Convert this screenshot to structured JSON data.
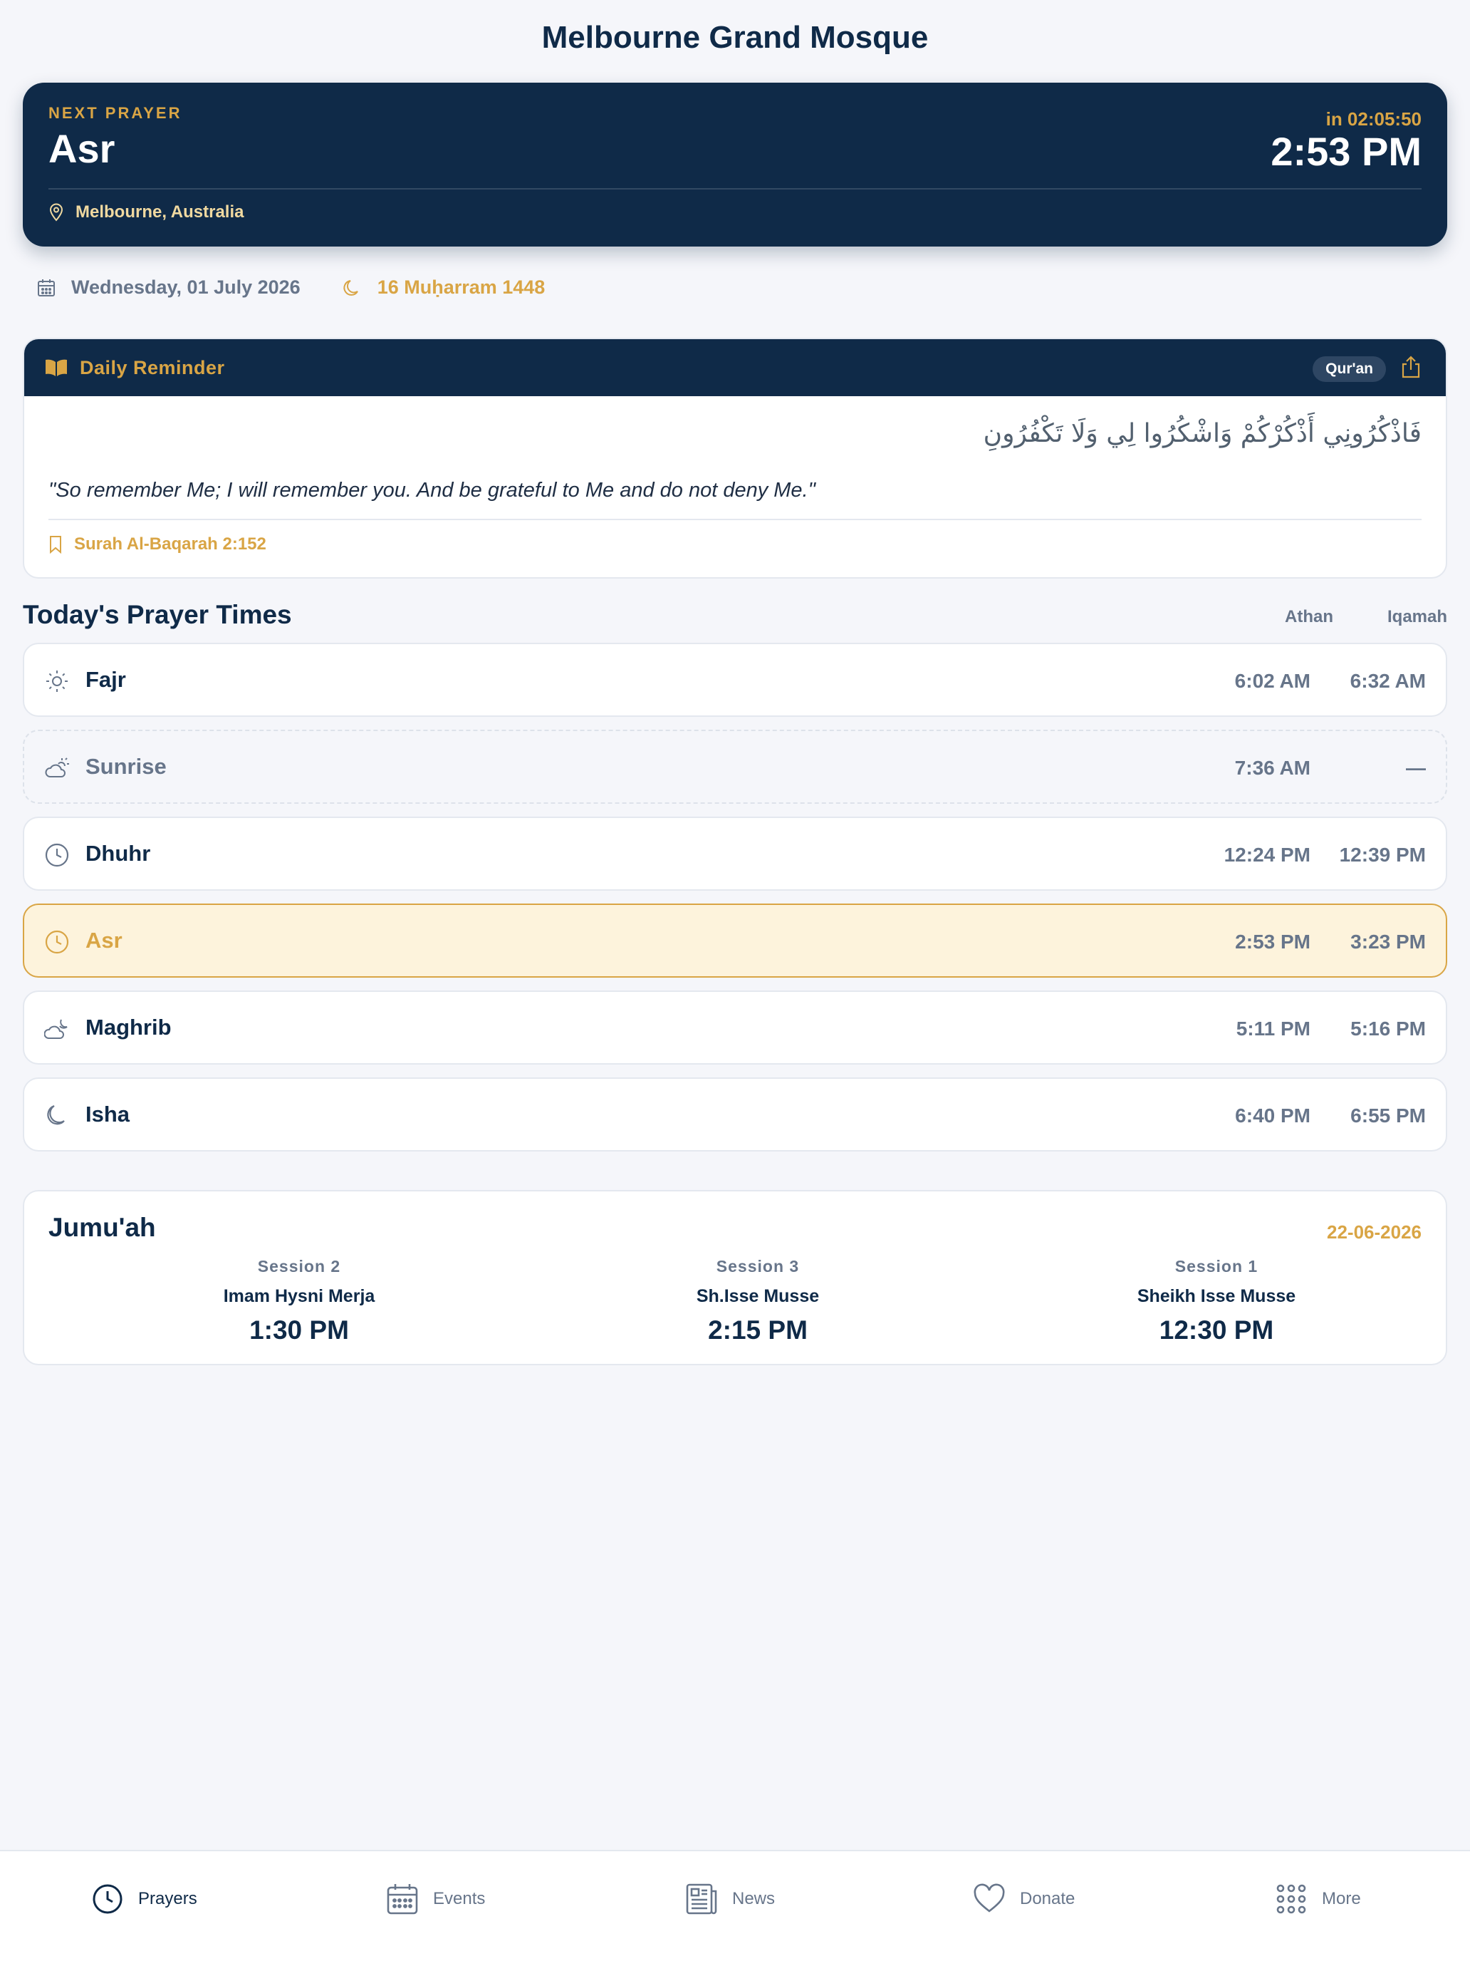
{
  "app": {
    "title": "Melbourne Grand Mosque"
  },
  "next_prayer": {
    "label": "NEXT PRAYER",
    "name": "Asr",
    "countdown": "in 02:05:50",
    "time": "2:53 PM",
    "location": "Melbourne, Australia"
  },
  "dates": {
    "gregorian": "Wednesday, 01 July 2026",
    "hijri": "16 Muḥarram 1448"
  },
  "reminder": {
    "title": "Daily Reminder",
    "tag": "Qur'an",
    "arabic": "فَاذْكُرُونِي أَذْكُرْكُمْ وَاشْكُرُوا لِي وَلَا تَكْفُرُونِ",
    "translation": "\"So remember Me; I will remember you. And be grateful to Me and do not deny Me.\"",
    "reference": "Surah Al-Baqarah 2:152"
  },
  "prayer_times": {
    "title": "Today's Prayer Times",
    "col_athan": "Athan",
    "col_iqamah": "Iqamah",
    "rows": [
      {
        "name": "Fajr",
        "athan": "6:02 AM",
        "iqamah": "6:32 AM",
        "icon": "sun-icon"
      },
      {
        "name": "Sunrise",
        "athan": "7:36 AM",
        "iqamah": "—",
        "icon": "sunrise-cloud-icon"
      },
      {
        "name": "Dhuhr",
        "athan": "12:24 PM",
        "iqamah": "12:39 PM",
        "icon": "clock-icon"
      },
      {
        "name": "Asr",
        "athan": "2:53 PM",
        "iqamah": "3:23 PM",
        "icon": "clock-icon"
      },
      {
        "name": "Maghrib",
        "athan": "5:11 PM",
        "iqamah": "5:16 PM",
        "icon": "cloud-moon-icon"
      },
      {
        "name": "Isha",
        "athan": "6:40 PM",
        "iqamah": "6:55 PM",
        "icon": "moon-icon"
      }
    ]
  },
  "jumuah": {
    "title": "Jumu'ah",
    "date": "22-06-2026",
    "sessions": [
      {
        "label": "Session 2",
        "imam": "Imam Hysni Merja",
        "time": "1:30 PM"
      },
      {
        "label": "Session 3",
        "imam": "Sh.Isse Musse",
        "time": "2:15 PM"
      },
      {
        "label": "Session 1",
        "imam": "Sheikh Isse Musse",
        "time": "12:30 PM"
      }
    ]
  },
  "nav": {
    "items": [
      {
        "label": "Prayers",
        "icon": "clock-icon",
        "active": true
      },
      {
        "label": "Events",
        "icon": "calendar-icon"
      },
      {
        "label": "News",
        "icon": "newspaper-icon"
      },
      {
        "label": "Donate",
        "icon": "heart-icon"
      },
      {
        "label": "More",
        "icon": "grid-icon"
      }
    ]
  },
  "colors": {
    "navy": "#0f2a48",
    "gold": "#d9a545",
    "muted": "#67758a",
    "highlight_bg": "#fdf3dc",
    "background": "#f5f6fa"
  }
}
